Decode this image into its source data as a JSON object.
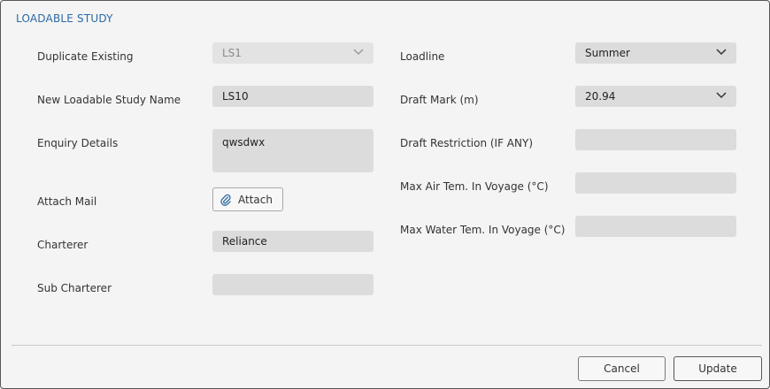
{
  "dialog": {
    "title": "LOADABLE STUDY"
  },
  "left": {
    "duplicate_existing": {
      "label": "Duplicate Existing",
      "value": "LS1"
    },
    "new_name": {
      "label": "New Loadable Study Name",
      "value": "LS10"
    },
    "enquiry": {
      "label": "Enquiry Details",
      "value": "qwsdwx"
    },
    "attach_mail": {
      "label": "Attach Mail",
      "button": "Attach"
    },
    "charterer": {
      "label": "Charterer",
      "value": "Reliance"
    },
    "sub_charterer": {
      "label": "Sub Charterer",
      "value": ""
    }
  },
  "right": {
    "loadline": {
      "label": "Loadline",
      "value": "Summer"
    },
    "draft_mark": {
      "label": "Draft Mark (m)",
      "value": "20.94"
    },
    "draft_restriction": {
      "label": "Draft Restriction (IF ANY)",
      "value": ""
    },
    "max_air_temp": {
      "label": "Max Air Tem. In Voyage (°C)",
      "value": ""
    },
    "max_water_temp": {
      "label": "Max Water Tem. In Voyage (°C)",
      "value": ""
    }
  },
  "footer": {
    "cancel": "Cancel",
    "update": "Update"
  },
  "icons": {
    "dropdown": "chevron-down-icon",
    "attach": "paperclip-icon"
  },
  "colors": {
    "title": "#2b6aa3",
    "field_bg": "#dcdcdc"
  }
}
